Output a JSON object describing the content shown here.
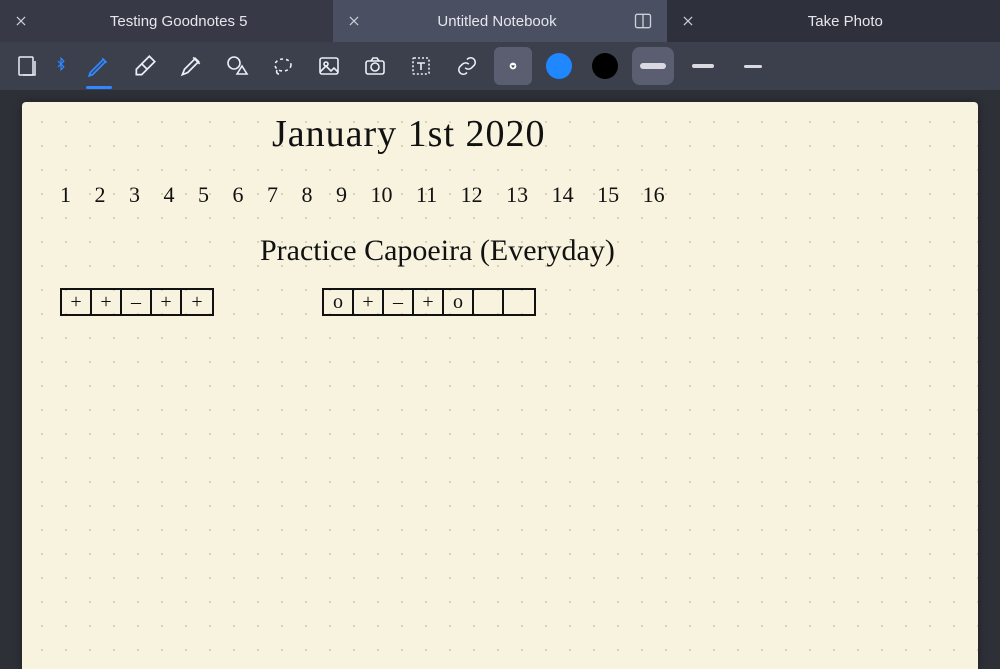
{
  "tabs": {
    "left": {
      "title": "Testing Goodnotes 5"
    },
    "active": {
      "title": "Untitled Notebook"
    },
    "right": {
      "title": "Take Photo"
    }
  },
  "toolbar": {
    "bluetooth": true,
    "tools": [
      "pen",
      "eraser",
      "highlighter",
      "shape",
      "lasso",
      "image",
      "camera",
      "text",
      "link"
    ],
    "selected_tool": "pen",
    "colors": {
      "c1": "#1f87ff",
      "c2": "#000000"
    },
    "strokes": {
      "thick": 6,
      "medium": 4,
      "thin": 2
    },
    "selected_stroke": "thick"
  },
  "page": {
    "title": "January 1st 2020",
    "numbers": "1  2  3  4  5  6  7   8  9   10  11   12  13  14  15  16",
    "task": "Practice Capoeira (Everyday)",
    "tracker1": [
      "+",
      "+",
      "–",
      "+",
      "+"
    ],
    "tracker2": [
      "o",
      "+",
      "–",
      "+",
      "o",
      "",
      ""
    ]
  }
}
